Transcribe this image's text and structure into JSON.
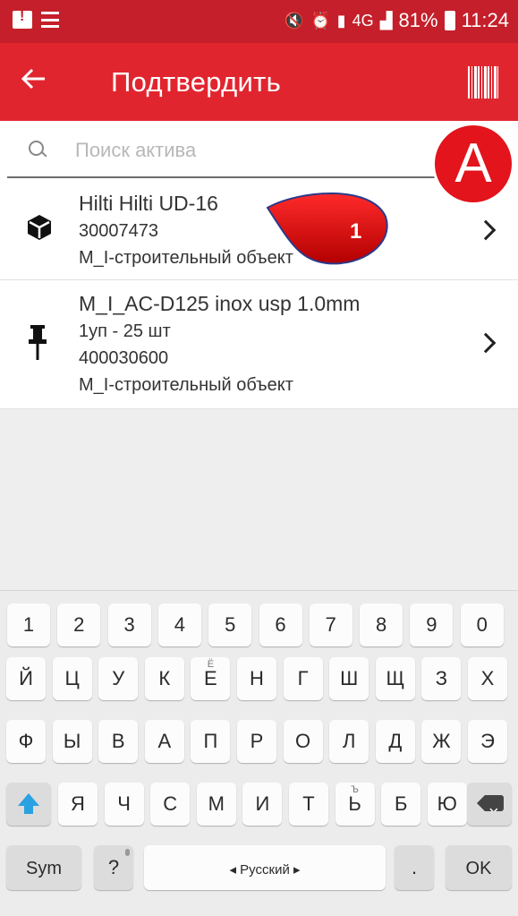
{
  "status_bar": {
    "network": "4G",
    "battery": "81%",
    "time": "11:24"
  },
  "app_bar": {
    "title": "Подтвердить"
  },
  "search": {
    "placeholder": "Поиск актива"
  },
  "annotations": {
    "a_label": "A",
    "one_label": "1"
  },
  "list": {
    "items": [
      {
        "title": "Hilti Hilti UD-16",
        "lines": [
          "30007473",
          "M_I-строительный объект"
        ],
        "icon": "box-icon"
      },
      {
        "title": "M_I_AC-D125 inox usp 1.0mm",
        "lines": [
          "1уп - 25 шт",
          "400030600",
          "M_I-строительный объект"
        ],
        "icon": "pin-icon"
      }
    ]
  },
  "keyboard": {
    "row1": [
      "1",
      "2",
      "3",
      "4",
      "5",
      "6",
      "7",
      "8",
      "9",
      "0"
    ],
    "row2": [
      "Й",
      "Ц",
      "У",
      "К",
      "Е",
      "Н",
      "Г",
      "Ш",
      "Щ",
      "З",
      "Х"
    ],
    "row2_hint_e": "Ё",
    "row3": [
      "Ф",
      "Ы",
      "В",
      "А",
      "П",
      "Р",
      "О",
      "Л",
      "Д",
      "Ж",
      "Э"
    ],
    "row4": [
      "Я",
      "Ч",
      "С",
      "М",
      "И",
      "Т",
      "Ь",
      "Б",
      "Ю"
    ],
    "row4_hint_soft": "Ъ",
    "sym": "Sym",
    "question": "?",
    "language": "◂ Русский ▸",
    "period": ".",
    "ok": "OK"
  }
}
